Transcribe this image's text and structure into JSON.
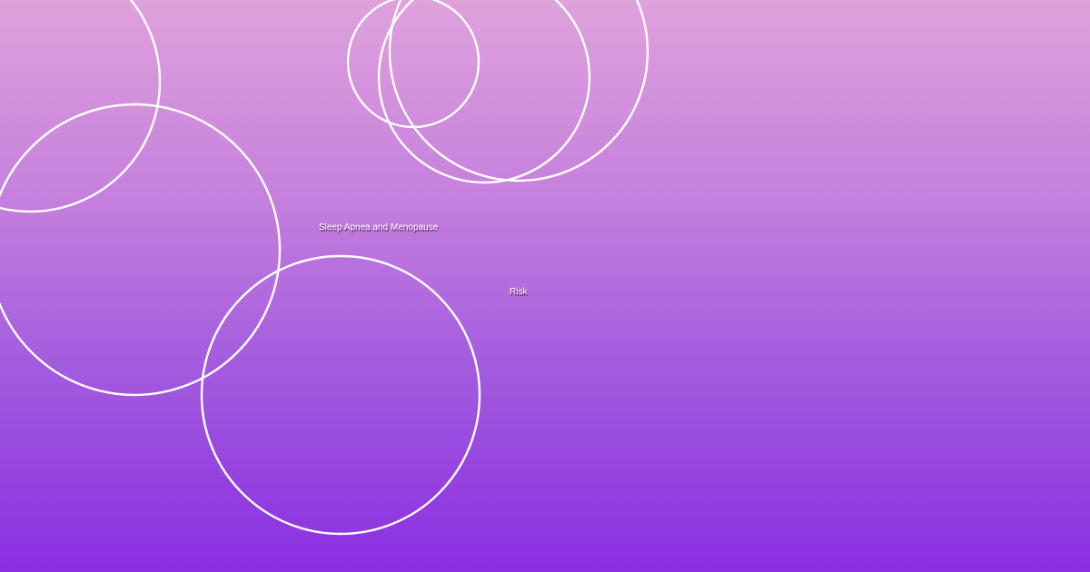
{
  "banner": {
    "title": "Sleep Apnea and Menopause",
    "subtitle": "Risk",
    "colors": {
      "gradient_top": "#dfa2dc",
      "gradient_bottom": "#8a2ee2",
      "ring_stroke": "#ffffff"
    },
    "decoration": "outline-circles"
  }
}
